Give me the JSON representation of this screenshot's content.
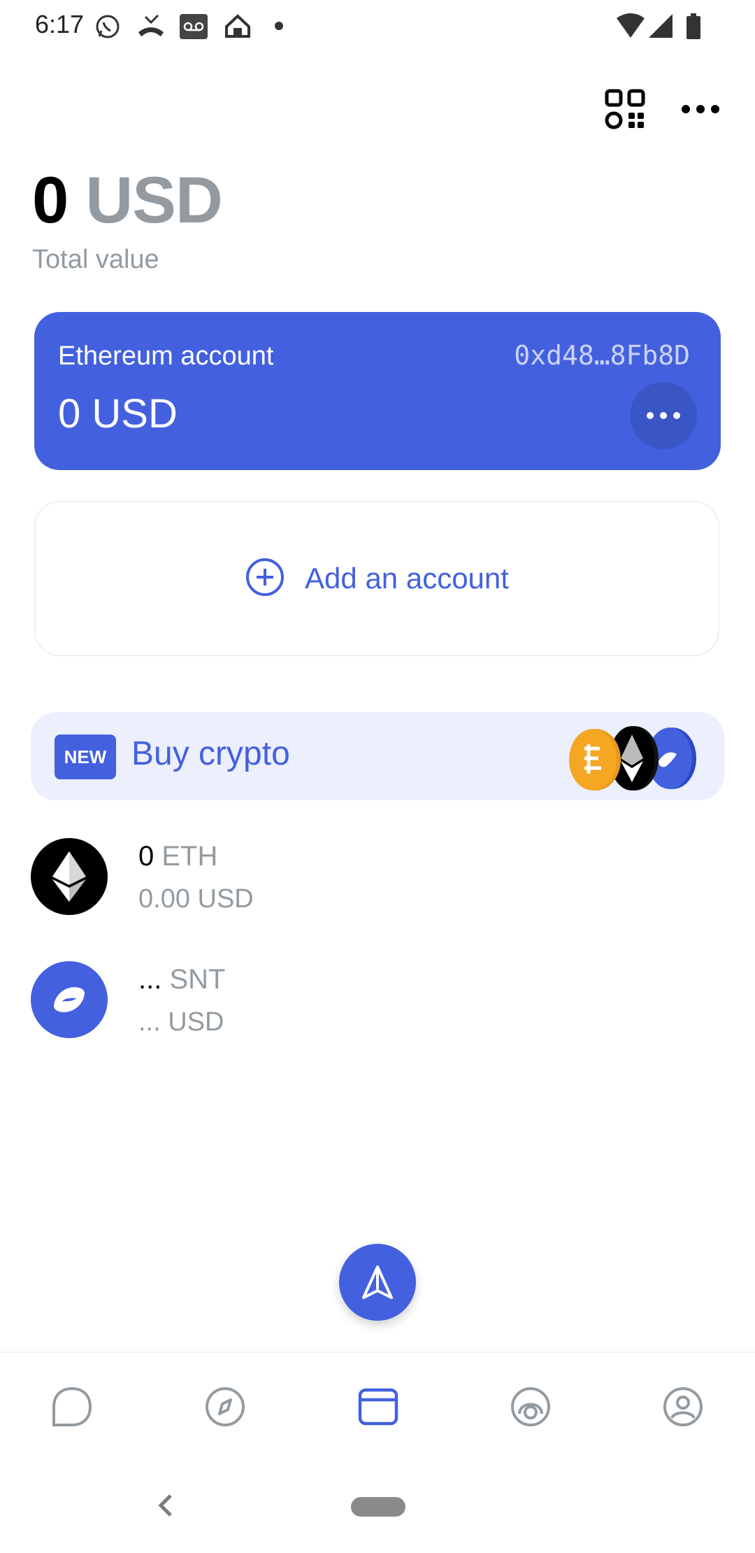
{
  "status_bar": {
    "time": "6:17",
    "left_icons": [
      "whatsapp-icon",
      "missed-call-icon",
      "voicemail-icon",
      "home-icon",
      "dot-icon"
    ],
    "right_icons": [
      "wifi-icon",
      "signal-icon",
      "battery-icon"
    ]
  },
  "header": {
    "actions": [
      "qr-code-icon",
      "more-icon"
    ]
  },
  "total": {
    "amount": "0",
    "currency": "USD",
    "label": "Total value"
  },
  "account": {
    "name": "Ethereum account",
    "address": "0xd48…8Fb8D",
    "balance": "0 USD",
    "color": "#4360df"
  },
  "add_account": {
    "label": "Add an account"
  },
  "buy_banner": {
    "badge": "NEW",
    "label": "Buy crypto"
  },
  "assets": [
    {
      "amount": "0",
      "symbol": "ETH",
      "usd": "0.00 USD",
      "icon": "ethereum-icon"
    },
    {
      "amount": "...",
      "symbol": "SNT",
      "usd": "... USD",
      "icon": "status-icon"
    }
  ],
  "bottom_nav": {
    "items": [
      "chats-icon",
      "browser-icon",
      "wallet-icon",
      "status-icon",
      "profile-icon"
    ],
    "active": "wallet-icon"
  },
  "colors": {
    "accent": "#4360df",
    "muted": "#939ba1",
    "banner_bg": "#eceffc"
  }
}
